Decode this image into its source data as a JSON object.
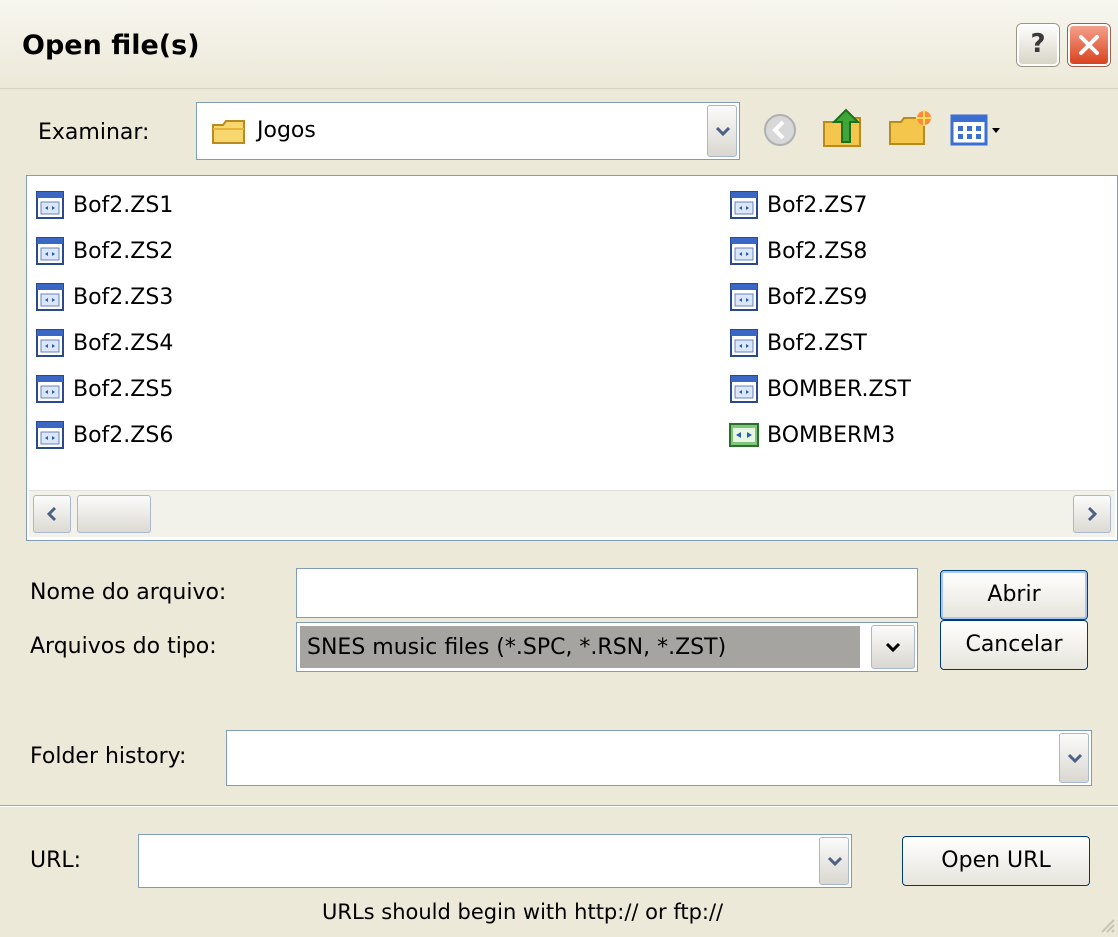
{
  "window": {
    "title": "Open file(s)",
    "help_glyph": "?"
  },
  "lookin": {
    "label": "Examinar:",
    "value": "Jogos",
    "folder_icon": "folder-icon"
  },
  "toolbar": {
    "icons": [
      "back-icon",
      "up-folder-icon",
      "new-folder-icon",
      "view-menu-icon"
    ]
  },
  "files": {
    "col1": [
      "Bof2.ZS1",
      "Bof2.ZS2",
      "Bof2.ZS3",
      "Bof2.ZS4",
      "Bof2.ZS5",
      "Bof2.ZS6"
    ],
    "col2": [
      "Bof2.ZS7",
      "Bof2.ZS8",
      "Bof2.ZS9",
      "Bof2.ZST",
      "BOMBER.ZST",
      "BOMBERM3"
    ]
  },
  "filename": {
    "label": "Nome do arquivo:",
    "value": ""
  },
  "filetype": {
    "label": "Arquivos do tipo:",
    "value": "SNES music files (*.SPC, *.RSN, *.ZST)"
  },
  "history": {
    "label": "Folder history:",
    "value": ""
  },
  "url": {
    "label": "URL:",
    "value": "",
    "hint": "URLs should begin with http:// or ftp://"
  },
  "buttons": {
    "open": "Abrir",
    "cancel": "Cancelar",
    "open_url": "Open URL"
  }
}
